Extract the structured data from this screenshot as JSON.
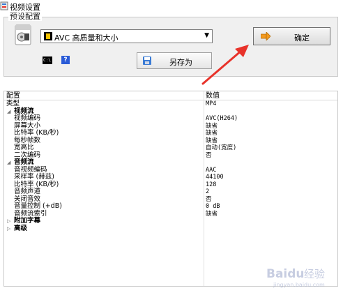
{
  "window": {
    "title": "视频设置"
  },
  "preset": {
    "legend": "预设配置",
    "selected": "AVC 高质量和大小",
    "ok_label": "确定",
    "saveas_label": "另存为",
    "cmd_icon_text": "C:\\"
  },
  "grid": {
    "col_name": "配置",
    "col_value": "数值",
    "rows": [
      {
        "kind": "plain",
        "name": "类型",
        "value": "MP4"
      },
      {
        "kind": "section",
        "name": "视频流",
        "value": "",
        "expanded": true
      },
      {
        "kind": "child",
        "name": "视频编码",
        "value": "AVC(H264)"
      },
      {
        "kind": "child",
        "name": "屏幕大小",
        "value": "缺省"
      },
      {
        "kind": "child",
        "name": "比特率 (KB/秒)",
        "value": "缺省"
      },
      {
        "kind": "child",
        "name": "每秒帧数",
        "value": "缺省"
      },
      {
        "kind": "child",
        "name": "宽高比",
        "value": "自动(宽度)"
      },
      {
        "kind": "child",
        "name": "二次编码",
        "value": "否"
      },
      {
        "kind": "section",
        "name": "音频流",
        "value": "",
        "expanded": true
      },
      {
        "kind": "child",
        "name": "音视频编码",
        "value": "AAC"
      },
      {
        "kind": "child",
        "name": "采样率 (赫兹)",
        "value": "44100"
      },
      {
        "kind": "child",
        "name": "比特率 (KB/秒)",
        "value": "128"
      },
      {
        "kind": "child",
        "name": "音频声道",
        "value": "2"
      },
      {
        "kind": "child",
        "name": "关闭音效",
        "value": "否"
      },
      {
        "kind": "child",
        "name": "音量控制 (+dB)",
        "value": "0 dB"
      },
      {
        "kind": "child",
        "name": "音频流索引",
        "value": "缺省"
      },
      {
        "kind": "section",
        "name": "附加字幕",
        "value": "",
        "expanded": false
      },
      {
        "kind": "section",
        "name": "高级",
        "value": "",
        "expanded": false
      }
    ]
  },
  "watermark": {
    "text": "Baidu 经验",
    "subtext": "jingyan.baidu.com"
  },
  "colors": {
    "arrow": "#e8322a",
    "ok_icon": "#f39a1e",
    "help": "#2a5bd7"
  }
}
